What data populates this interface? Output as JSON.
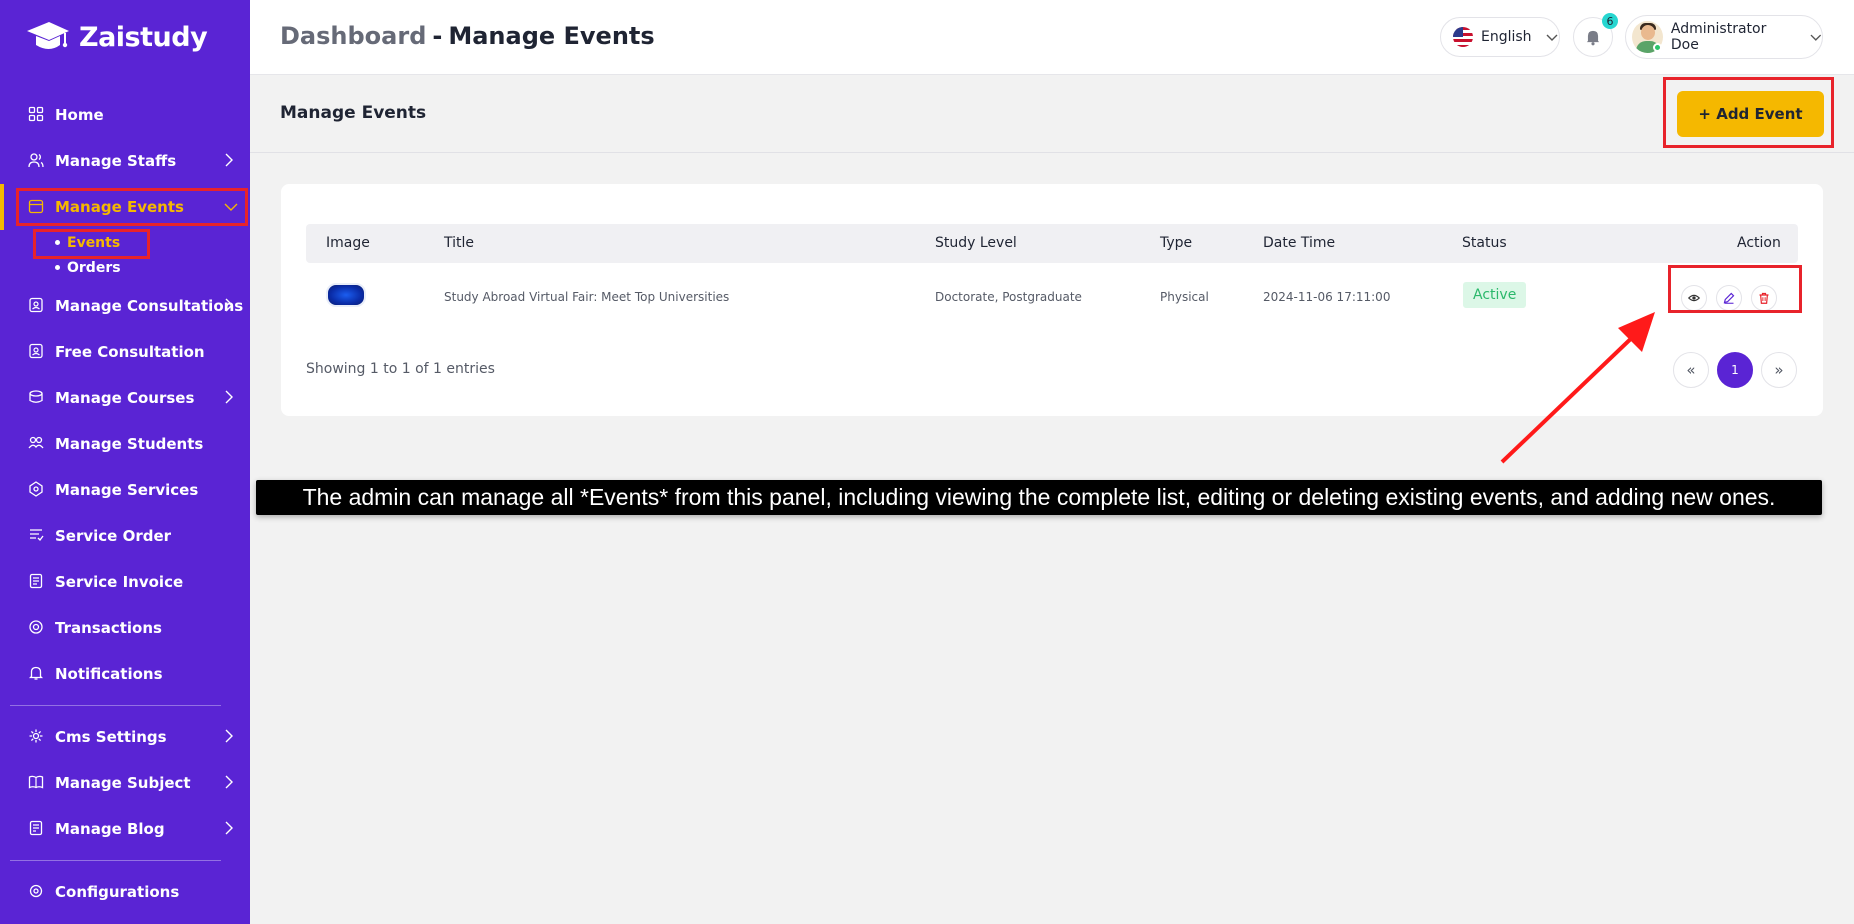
{
  "brand": {
    "name": "Zaistudy"
  },
  "sidebar": {
    "items": [
      {
        "label": "Home",
        "icon": "home-icon",
        "has_children": false
      },
      {
        "label": "Manage Staffs",
        "icon": "users-icon",
        "has_children": true
      },
      {
        "label": "Manage Events",
        "icon": "calendar-icon",
        "has_children": true,
        "active": true,
        "children": [
          {
            "label": "Events",
            "active": true
          },
          {
            "label": "Orders",
            "active": false
          }
        ]
      },
      {
        "label": "Manage Consultations",
        "icon": "consultation-icon",
        "has_children": true
      },
      {
        "label": "Free Consultation",
        "icon": "free-consultation-icon",
        "has_children": false
      },
      {
        "label": "Manage Courses",
        "icon": "courses-icon",
        "has_children": true
      },
      {
        "label": "Manage Students",
        "icon": "students-icon",
        "has_children": false
      },
      {
        "label": "Manage Services",
        "icon": "services-icon",
        "has_children": false
      },
      {
        "label": "Service Order",
        "icon": "order-icon",
        "has_children": false
      },
      {
        "label": "Service Invoice",
        "icon": "invoice-icon",
        "has_children": false
      },
      {
        "label": "Transactions",
        "icon": "transactions-icon",
        "has_children": false
      },
      {
        "label": "Notifications",
        "icon": "bell-icon",
        "has_children": false
      },
      {
        "label": "Cms Settings",
        "icon": "cms-icon",
        "has_children": true
      },
      {
        "label": "Manage Subject",
        "icon": "book-icon",
        "has_children": true
      },
      {
        "label": "Manage Blog",
        "icon": "blog-icon",
        "has_children": true
      },
      {
        "label": "Configurations",
        "icon": "settings-icon",
        "has_children": false
      }
    ]
  },
  "header": {
    "breadcrumb_root": "Dashboard",
    "breadcrumb_separator": "-",
    "breadcrumb_current": "Manage Events",
    "language": "English",
    "notification_count": "6",
    "user_name": "Administrator Doe"
  },
  "page": {
    "title": "Manage Events",
    "add_button": "+ Add Event"
  },
  "table": {
    "columns": [
      "Image",
      "Title",
      "Study Level",
      "Type",
      "Date Time",
      "Status",
      "Action"
    ],
    "rows": [
      {
        "title": "Study Abroad Virtual Fair: Meet Top Universities",
        "study_level": "Doctorate, Postgraduate",
        "type": "Physical",
        "date_time": "2024-11-06 17:11:00",
        "status": "Active"
      }
    ],
    "info": "Showing 1 to 1 of 1 entries",
    "pagination": {
      "prev": "«",
      "current": "1",
      "next": "»"
    }
  },
  "caption": "The admin can manage all *Events* from this panel, including viewing the complete list, editing or deleting existing events, and adding new ones.",
  "colors": {
    "sidebar": "#5a24d4",
    "accent": "#f5b800",
    "highlight": "#e8232b",
    "status_active_bg": "#dcf7e7",
    "status_active_text": "#2bb86b"
  }
}
